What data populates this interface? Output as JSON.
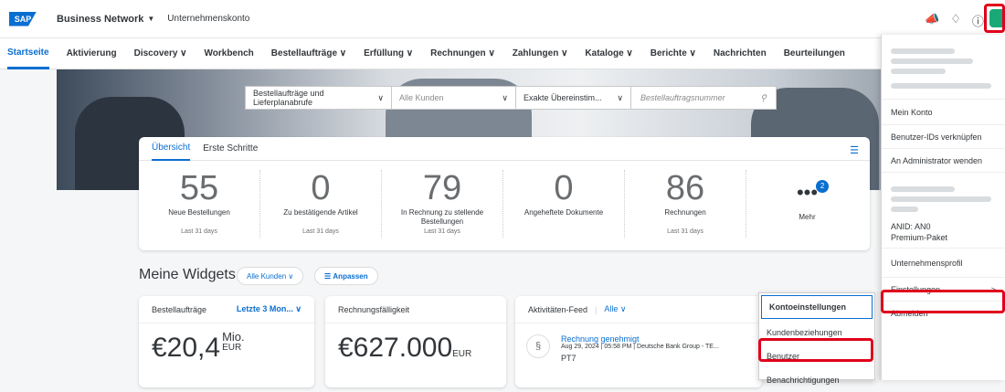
{
  "header": {
    "logo": "SAP",
    "brand": "Business Network",
    "brand_caret": "▼",
    "company": "Unternehmenskonto",
    "icons": [
      "megaphone-icon",
      "bell-icon",
      "help-icon"
    ]
  },
  "nav": [
    "Startseite",
    "Aktivierung",
    "Discovery ∨",
    "Workbench",
    "Bestellaufträge ∨",
    "Erfüllung ∨",
    "Rechnungen ∨",
    "Zahlungen ∨",
    "Kataloge ∨",
    "Berichte ∨",
    "Nachrichten",
    "Beurteilungen"
  ],
  "search": {
    "doc_type": "Bestellaufträge und Lieferplanabrufe",
    "customers": "Alle Kunden",
    "match": "Exakte Übereinstim...",
    "placeholder": "Bestellauftragsnummer"
  },
  "overview": {
    "tabs": [
      "Übersicht",
      "Erste Schritte"
    ],
    "tiles": [
      {
        "num": "55",
        "label": "Neue Bestellungen",
        "sub": "Last 31 days"
      },
      {
        "num": "0",
        "label": "Zu bestätigende Artikel",
        "sub": "Last 31 days"
      },
      {
        "num": "79",
        "label": "In Rechnung zu stellende Bestellungen",
        "sub": "Last 31 days"
      },
      {
        "num": "0",
        "label": "Angeheftete Dokumente",
        "sub": ""
      },
      {
        "num": "86",
        "label": "Rechnungen",
        "sub": "Last 31 days"
      }
    ],
    "more": {
      "label": "Mehr",
      "badge": "2"
    }
  },
  "widgets": {
    "title": "Meine Widgets",
    "filter": "Alle Kunden ∨",
    "customize": "Anpassen",
    "orders": {
      "title": "Bestellaufträge",
      "range": "Letzte 3 Mon... ∨",
      "value": "€20,4",
      "unit": "Mio.",
      "currency": "EUR"
    },
    "due": {
      "title": "Rechnungsfälligkeit",
      "value": "€627.000",
      "currency": "EUR"
    },
    "feed": {
      "title": "Aktivitäten-Feed",
      "filter": "Alle ∨",
      "item_title": "Rechnung genehmigt",
      "item_meta": "Aug 29, 2024 | 05:58 PM | Deutsche Bank Group - TE...",
      "item_id": "PT7"
    }
  },
  "account_menu": [
    "Kontoeinstellungen",
    "Kundenbeziehungen",
    "Benutzer",
    "Benachrichtigungen"
  ],
  "user_menu": {
    "items": [
      "Mein Konto",
      "Benutzer-IDs verknüpfen",
      "An Administrator wenden"
    ],
    "anid": "ANID: AN0",
    "plan": "Premium-Paket",
    "profile": "Unternehmensprofil",
    "settings": "Einstellungen",
    "settings_arrow": ">",
    "logout": "Abmelden"
  },
  "colors": {
    "accent": "#0a6ed1",
    "highlight": "#e0001b"
  }
}
